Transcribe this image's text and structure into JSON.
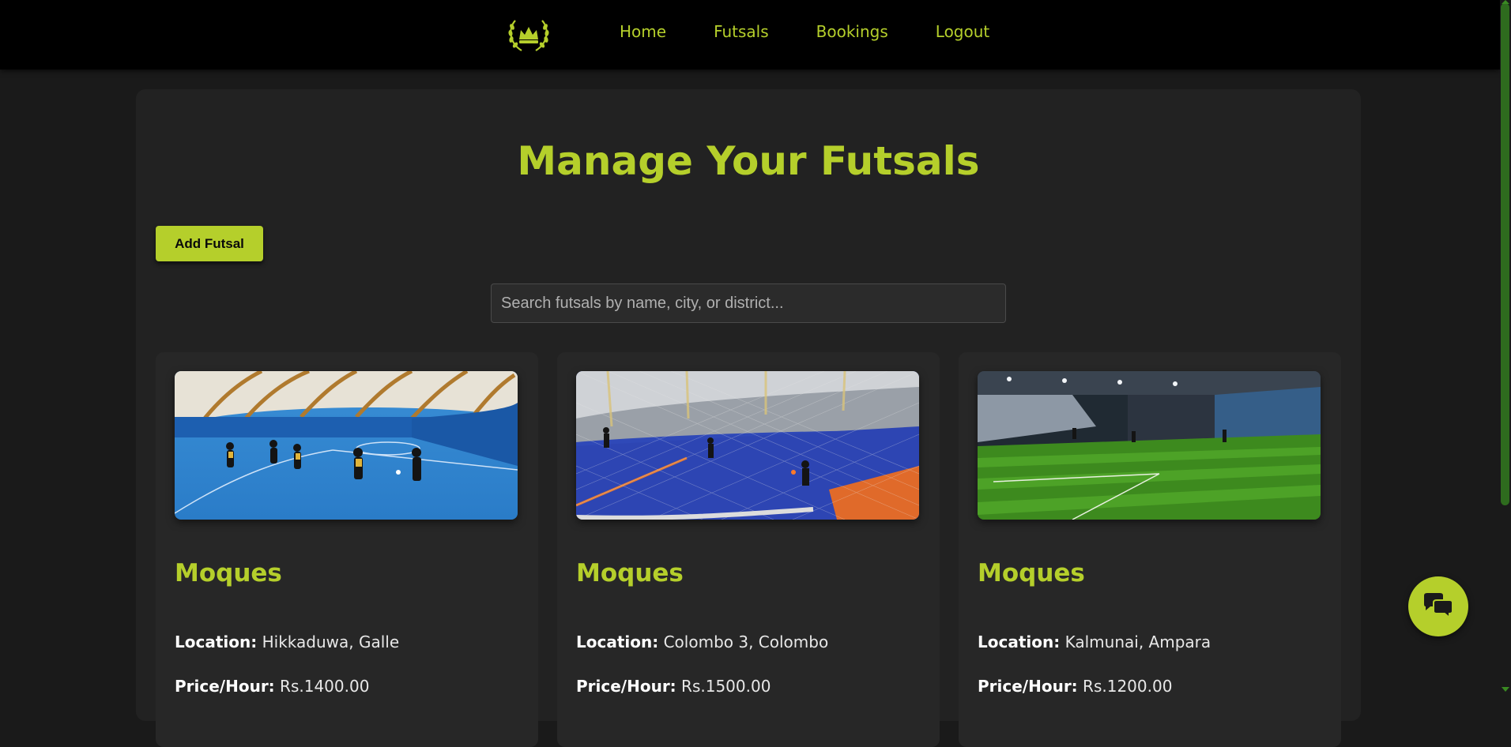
{
  "nav": {
    "logo_icon": "crown-laurel-logo",
    "links": [
      {
        "label": "Home"
      },
      {
        "label": "Futsals"
      },
      {
        "label": "Bookings"
      },
      {
        "label": "Logout"
      }
    ]
  },
  "main": {
    "title": "Manage Your Futsals",
    "add_button_label": "Add Futsal",
    "search_placeholder": "Search futsals by name, city, or district..."
  },
  "cards": [
    {
      "image": "indoor-futsal-dome-blue-court-photo",
      "name": "Moques",
      "location_label": "Location:",
      "location": "Hikkaduwa, Galle",
      "price_label": "Price/Hour:",
      "price": "Rs.1400.00"
    },
    {
      "image": "netted-blue-futsal-court-photo",
      "name": "Moques",
      "location_label": "Location:",
      "location": "Colombo 3, Colombo",
      "price_label": "Price/Hour:",
      "price": "Rs.1500.00"
    },
    {
      "image": "indoor-artificial-turf-pitch-photo",
      "name": "Moques",
      "location_label": "Location:",
      "location": "Kalmunai, Ampara",
      "price_label": "Price/Hour:",
      "price": "Rs.1200.00"
    }
  ],
  "chat": {
    "icon": "chat-bubbles-icon"
  },
  "colors": {
    "accent": "#b5cf2b",
    "navbar_bg": "#000000",
    "page_bg": "#1a1a1a",
    "container_bg": "#222222",
    "card_bg": "#272727"
  }
}
